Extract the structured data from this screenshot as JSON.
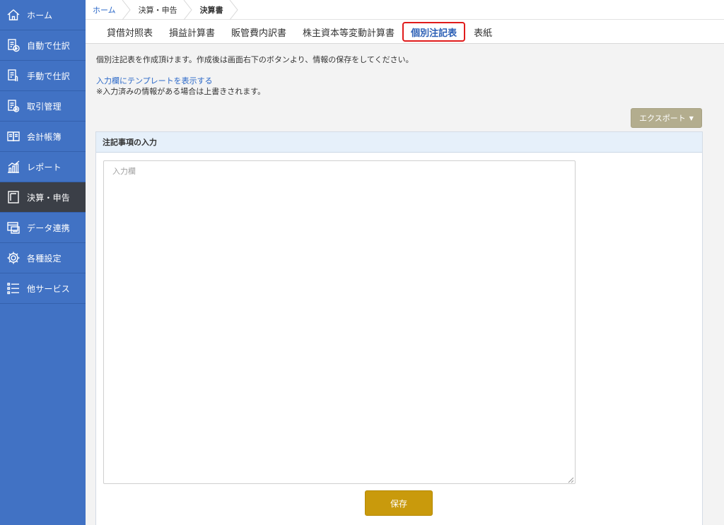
{
  "sidebar": {
    "items": [
      {
        "label": "ホーム",
        "icon": "home-icon"
      },
      {
        "label": "自動で仕訳",
        "icon": "auto-journal-icon"
      },
      {
        "label": "手動で仕訳",
        "icon": "manual-journal-icon"
      },
      {
        "label": "取引管理",
        "icon": "transaction-icon"
      },
      {
        "label": "会計帳簿",
        "icon": "ledger-book-icon"
      },
      {
        "label": "レポート",
        "icon": "report-chart-icon"
      },
      {
        "label": "決算・申告",
        "icon": "settlement-icon"
      },
      {
        "label": "データ連携",
        "icon": "data-link-icon"
      },
      {
        "label": "各種設定",
        "icon": "gear-icon"
      },
      {
        "label": "他サービス",
        "icon": "list-icon"
      }
    ],
    "active_index": 6,
    "bg_color": "#4172c4",
    "active_color": "#3b3f47"
  },
  "breadcrumb": {
    "items": [
      "ホーム",
      "決算・申告",
      "決算書"
    ]
  },
  "tabs": {
    "items": [
      "貸借対照表",
      "損益計算書",
      "販管費内訳書",
      "株主資本等変動計算書",
      "個別注記表",
      "表紙"
    ],
    "active_index": 4,
    "highlight_color": "#e01b1b"
  },
  "main": {
    "description": "個別注記表を作成頂けます。作成後は画面右下のボタンより、情報の保存をしてください。",
    "template_link": "入力欄にテンプレートを表示する",
    "note": "※入力済みの情報がある場合は上書きされます。",
    "export_label": "エクスポート",
    "panel_title": "注記事項の入力",
    "input_placeholder": "入力欄",
    "input_value": "",
    "save_label": "保存",
    "save_color": "#c99a0c",
    "export_color": "#b3ad8e"
  }
}
